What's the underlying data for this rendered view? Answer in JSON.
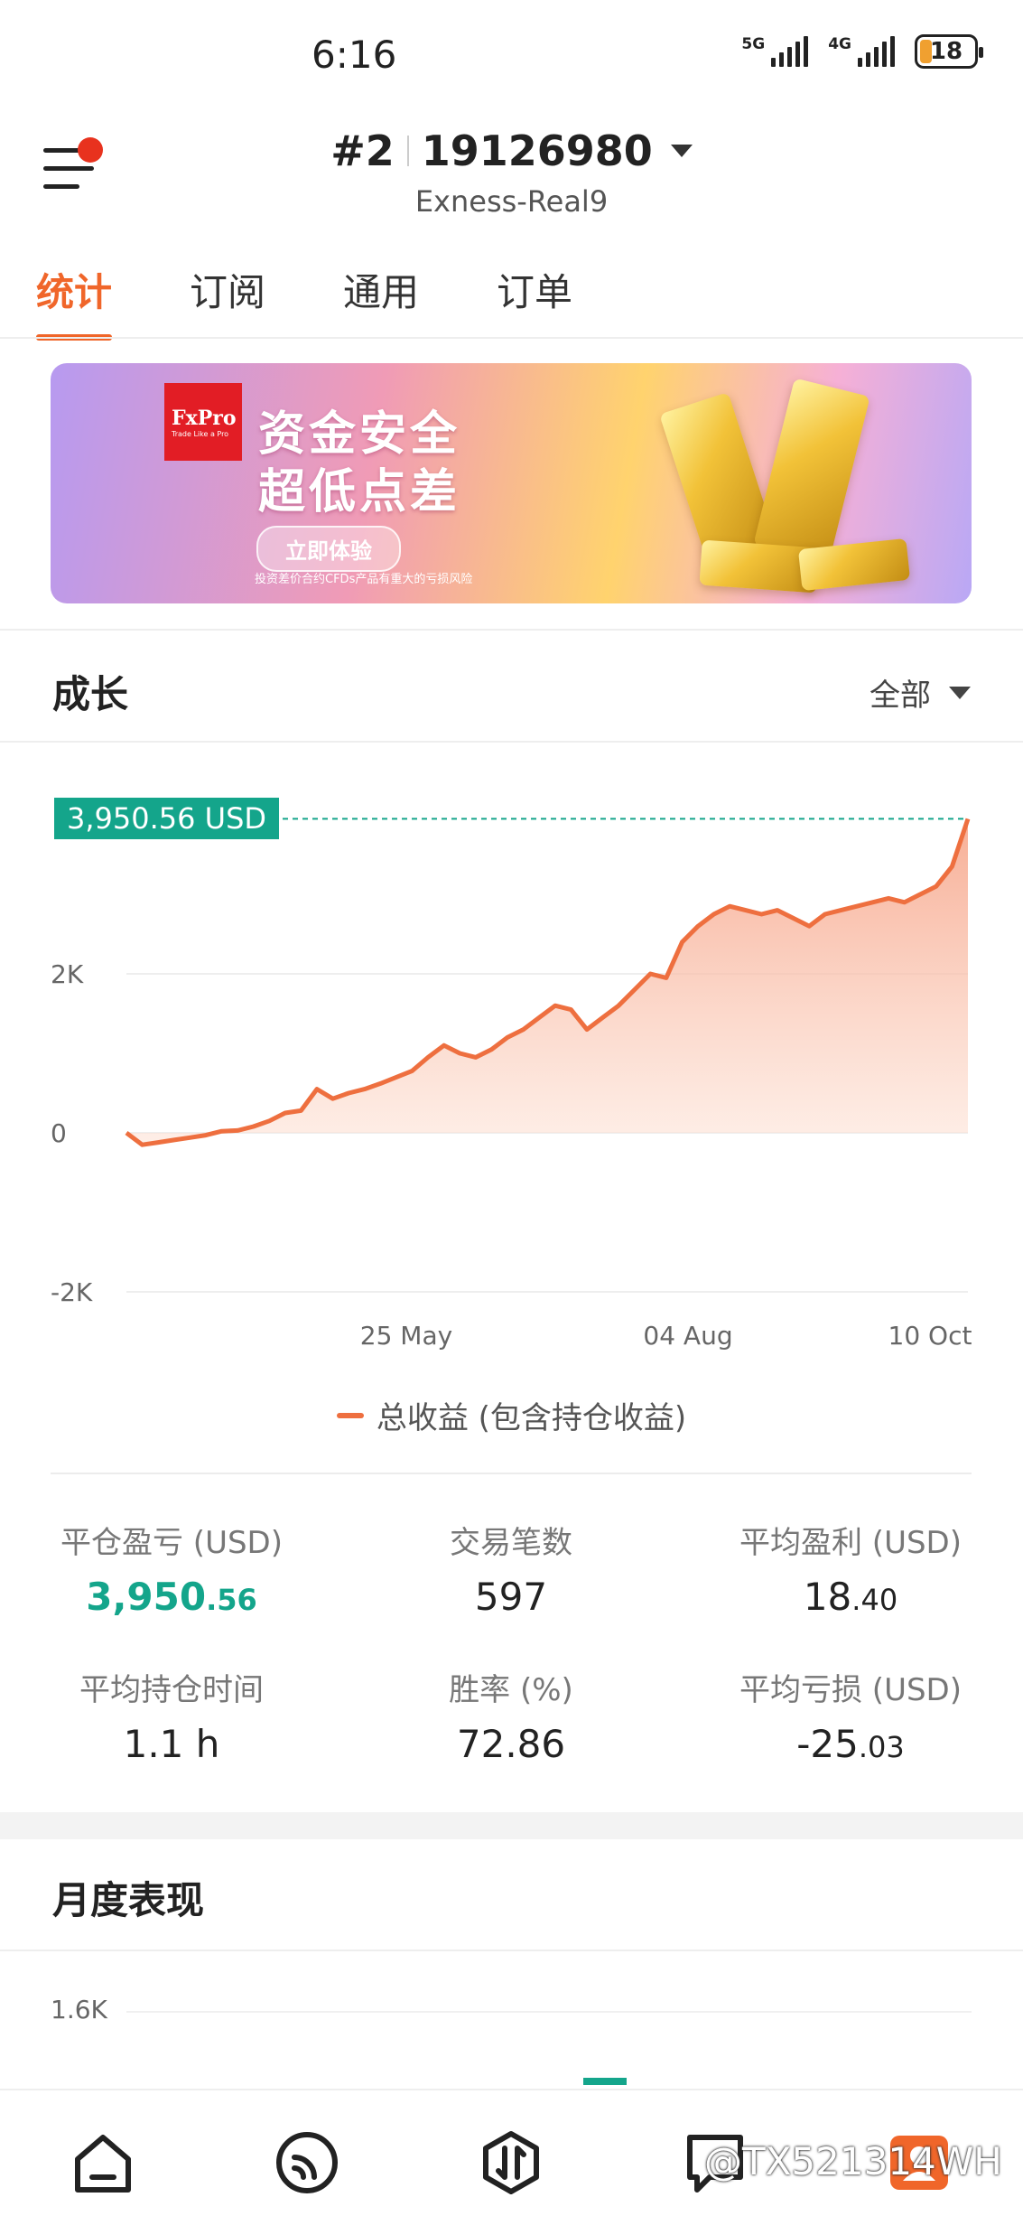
{
  "status_bar": {
    "time": "6:16",
    "sig1": "5G",
    "sig2": "4G",
    "battery": "18"
  },
  "header": {
    "account_no": "#2",
    "account_id": "19126980",
    "server": "Exness-Real9"
  },
  "tabs": [
    {
      "label": "统计",
      "active": true
    },
    {
      "label": "订阅",
      "active": false
    },
    {
      "label": "通用",
      "active": false
    },
    {
      "label": "订单",
      "active": false
    }
  ],
  "banner": {
    "brand": "FxPro",
    "brand_tagline": "Trade Like a Pro",
    "headline_1": "资金安全",
    "headline_2": "超低点差",
    "cta": "立即体验",
    "disclaimer": "投资差价合约CFDs产品有重大的亏损风险"
  },
  "growth": {
    "title": "成长",
    "range": "全部",
    "current_value_label": "3,950.56 USD",
    "legend": "总收益 (包含持仓收益)"
  },
  "chart_data": {
    "type": "area",
    "title": "",
    "yticks": [
      "2K",
      "0",
      "-2K"
    ],
    "xticks": [
      "25 May",
      "04 Aug",
      "10 Oct"
    ],
    "ylim": [
      -2000,
      4000
    ],
    "ylabel": "",
    "xlabel": "",
    "series": [
      {
        "name": "总收益 (包含持仓收益)",
        "color": "#ee6f3f",
        "values": [
          0,
          -150,
          -120,
          -90,
          -60,
          -30,
          20,
          30,
          80,
          150,
          250,
          280,
          550,
          430,
          500,
          550,
          620,
          700,
          780,
          950,
          1100,
          1000,
          950,
          1050,
          1200,
          1300,
          1450,
          1600,
          1550,
          1300,
          1450,
          1600,
          1800,
          2000,
          1950,
          2400,
          2600,
          2750,
          2850,
          2800,
          2750,
          2800,
          2700,
          2600,
          2750,
          2800,
          2850,
          2900,
          2950,
          2900,
          3000,
          3100,
          3350,
          3950.56
        ]
      }
    ],
    "current_value": 3950.56
  },
  "stats": [
    {
      "label": "平仓盈亏 (USD)",
      "int": "3,950",
      "dec": ".56",
      "green": true
    },
    {
      "label": "交易笔数",
      "int": "597",
      "dec": "",
      "green": false
    },
    {
      "label": "平均盈利 (USD)",
      "int": "18",
      "dec": ".40",
      "green": false
    },
    {
      "label": "平均持仓时间",
      "int": "1.1 h",
      "dec": "",
      "green": false
    },
    {
      "label": "胜率 (%)",
      "int": "72.86",
      "dec": "",
      "green": false
    },
    {
      "label": "平均亏损 (USD)",
      "int": "-25",
      "dec": ".03",
      "green": false
    }
  ],
  "monthly": {
    "title": "月度表现",
    "ytick": "1.6K"
  },
  "nav": [
    "home-icon",
    "feed-icon",
    "trade-icon",
    "messages-icon",
    "profile-icon"
  ],
  "watermark": "@TX521314WH",
  "colors": {
    "accent": "#f0662a",
    "teal": "#14a58b",
    "line": "#ee6f3f"
  }
}
